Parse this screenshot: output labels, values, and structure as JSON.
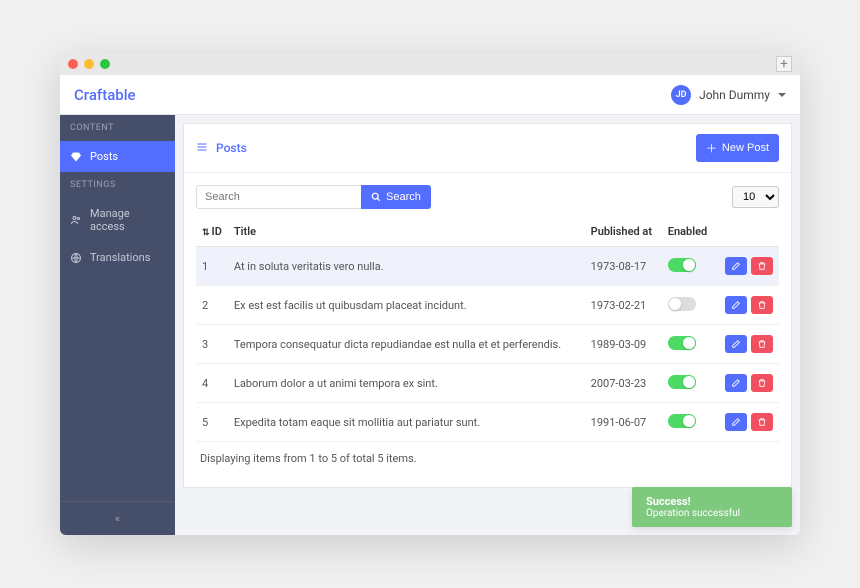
{
  "brand": "Craftable",
  "user": {
    "initials": "JD",
    "name": "John Dummy"
  },
  "sidebar": {
    "section1": "CONTENT",
    "section2": "SETTINGS",
    "items": {
      "posts": "Posts",
      "access": "Manage access",
      "translations": "Translations"
    }
  },
  "page": {
    "title": "Posts",
    "new_btn": "New Post",
    "search_placeholder": "Search",
    "search_btn": "Search",
    "page_size": "10",
    "columns": {
      "id": "ID",
      "title": "Title",
      "published": "Published at",
      "enabled": "Enabled"
    },
    "rows": [
      {
        "id": "1",
        "title": "At in soluta veritatis vero nulla.",
        "published": "1973-08-17",
        "enabled": true,
        "hl": true
      },
      {
        "id": "2",
        "title": "Ex est est facilis ut quibusdam placeat incidunt.",
        "published": "1973-02-21",
        "enabled": false
      },
      {
        "id": "3",
        "title": "Tempora consequatur dicta repudiandae est nulla et et perferendis.",
        "published": "1989-03-09",
        "enabled": true
      },
      {
        "id": "4",
        "title": "Laborum dolor a ut animi tempora ex sint.",
        "published": "2007-03-23",
        "enabled": true
      },
      {
        "id": "5",
        "title": "Expedita totam eaque sit mollitia aut pariatur sunt.",
        "published": "1991-06-07",
        "enabled": true
      }
    ],
    "pager_text": "Displaying items from 1 to 5 of total 5 items."
  },
  "toast": {
    "title": "Success!",
    "body": "Operation successful"
  }
}
